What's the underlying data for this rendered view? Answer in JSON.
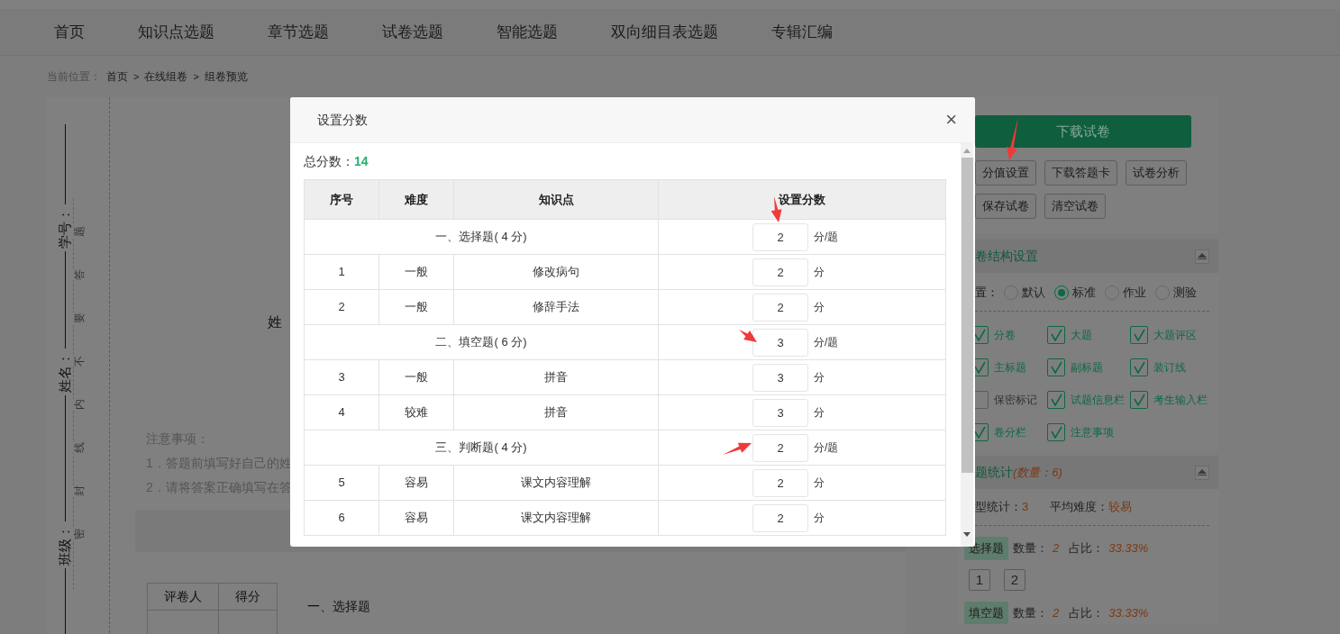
{
  "nav": {
    "items": [
      {
        "label": "首页"
      },
      {
        "label": "知识点选题"
      },
      {
        "label": "章节选题"
      },
      {
        "label": "试卷选题"
      },
      {
        "label": "智能选题"
      },
      {
        "label": "双向细目表选题"
      },
      {
        "label": "专辑汇编"
      }
    ]
  },
  "breadcrumb": {
    "label": "当前位置：",
    "parts": [
      {
        "kind": "link",
        "text": "首页"
      },
      {
        "kind": "sep",
        "text": ">"
      },
      {
        "kind": "link",
        "text": "在线组卷"
      },
      {
        "kind": "sep",
        "text": ">"
      },
      {
        "kind": "link",
        "text": "组卷预览"
      }
    ]
  },
  "paper": {
    "binding_fields": [
      "学号：",
      "姓名：",
      "班级："
    ],
    "seal_chars": [
      "密",
      "封",
      "线",
      "内",
      "不",
      "要",
      "答",
      "题"
    ],
    "student_label": "姓",
    "notes_title": "注意事项：",
    "notes": [
      "1．答题前填写好自己的姓",
      "2．请将答案正确填写在答"
    ],
    "score_table": {
      "columns": [
        "评卷人",
        "得分"
      ]
    },
    "section_title": "一、选择题"
  },
  "sidebar": {
    "download": "下载试卷",
    "buttons": [
      "分值设置",
      "下载答题卡",
      "试卷分析",
      "保存试卷",
      "清空试卷"
    ],
    "structure": {
      "title": "卷结构设置",
      "layout_label": "置：",
      "radios": [
        {
          "label": "默认",
          "selected": false
        },
        {
          "label": "标准",
          "selected": true
        },
        {
          "label": "作业",
          "selected": false
        },
        {
          "label": "测验",
          "selected": false
        }
      ],
      "checks": [
        {
          "label": "分卷",
          "checked": true
        },
        {
          "label": "大题",
          "checked": true
        },
        {
          "label": "大题评区",
          "checked": true
        },
        {
          "label": "主标题",
          "checked": true
        },
        {
          "label": "副标题",
          "checked": true
        },
        {
          "label": "装订线",
          "checked": true
        },
        {
          "label": "保密标记",
          "checked": false
        },
        {
          "label": "试题信息栏",
          "checked": true
        },
        {
          "label": "考生输入栏",
          "checked": true
        },
        {
          "label": "卷分栏",
          "checked": true
        },
        {
          "label": "注意事项",
          "checked": true
        }
      ]
    },
    "stats": {
      "title": "题统计",
      "count": "(数量：6)",
      "type_label": "型统计：",
      "type_count": "3",
      "avg_label": "平均难度：",
      "avg": "较易",
      "groups": [
        {
          "tag": "选择题",
          "count_label": "数量：",
          "count": "2",
          "ratio_label": "占比：",
          "ratio": "33.33%",
          "numbers": [
            "1",
            "2"
          ]
        },
        {
          "tag": "填空题",
          "count_label": "数量：",
          "count": "2",
          "ratio_label": "占比：",
          "ratio": "33.33%"
        }
      ]
    }
  },
  "modal": {
    "title": "设置分数",
    "close": "×",
    "total_label": "总分数：",
    "total": "14",
    "columns": [
      "序号",
      "难度",
      "知识点",
      "设置分数"
    ],
    "rows": [
      {
        "kind": "section",
        "title": "一、选择题( 4 分)",
        "score": "2",
        "unit": "分/题"
      },
      {
        "kind": "item",
        "no": "1",
        "difficulty": "一般",
        "topic": "修改病句",
        "score": "2",
        "unit": "分"
      },
      {
        "kind": "item",
        "no": "2",
        "difficulty": "一般",
        "topic": "修辞手法",
        "score": "2",
        "unit": "分"
      },
      {
        "kind": "section",
        "title": "二、填空题( 6 分)",
        "score": "3",
        "unit": "分/题"
      },
      {
        "kind": "item",
        "no": "3",
        "difficulty": "一般",
        "topic": "拼音",
        "score": "3",
        "unit": "分"
      },
      {
        "kind": "item",
        "no": "4",
        "difficulty": "较难",
        "topic": "拼音",
        "score": "3",
        "unit": "分"
      },
      {
        "kind": "section",
        "title": "三、判断题( 4 分)",
        "score": "2",
        "unit": "分/题"
      },
      {
        "kind": "item",
        "no": "5",
        "difficulty": "容易",
        "topic": "课文内容理解",
        "score": "2",
        "unit": "分"
      },
      {
        "kind": "item",
        "no": "6",
        "difficulty": "容易",
        "topic": "课文内容理解",
        "score": "2",
        "unit": "分"
      }
    ]
  }
}
